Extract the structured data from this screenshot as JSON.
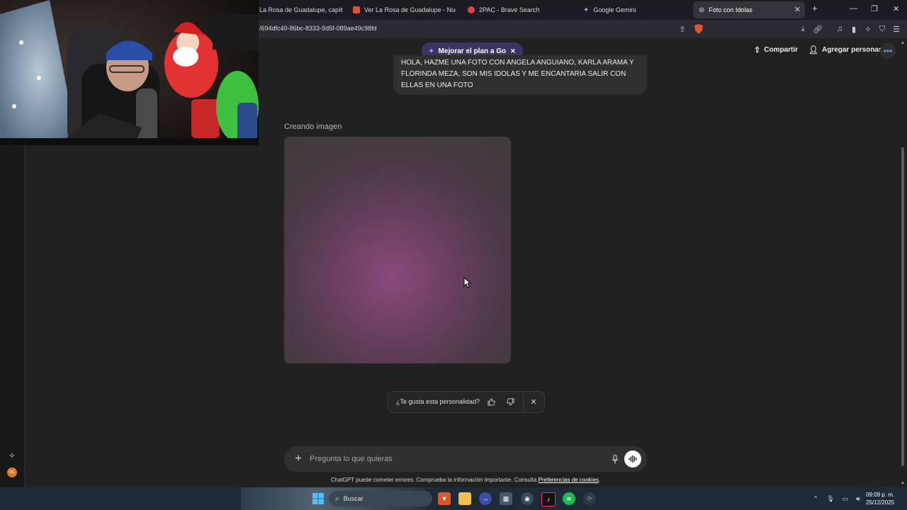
{
  "browser": {
    "tabs": [
      {
        "title": "La Rosa de Guadalupe, capítulo",
        "favicon_color": "#1c1b22"
      },
      {
        "title": "Ver La Rosa de Guadalupe - Nuevos",
        "favicon_color": "#e0552b"
      },
      {
        "title": "2PAC - Brave Search",
        "favicon_color": "#d8434d"
      },
      {
        "title": "Google Gemini",
        "favicon_color": "#8ab4f8"
      },
      {
        "title": "Foto con Idolas",
        "favicon_color": "#bbbbbb",
        "active": true
      }
    ],
    "new_tab": "+",
    "url": "/694dfc40-86bc-8333-9d5f-089ae49c98fd"
  },
  "header": {
    "upgrade_label": "Mejorar el plan a Go",
    "share_label": "Compartir",
    "add_people_label": "Agregar personas"
  },
  "chat": {
    "user_message": "HOLA, HAZME UNA FOTO CON ANGELA ANGUIANO, KARLA ARAMA Y FLORINDA MEZA, SON MIS IDOLAS Y ME ENCANTARIA SALIR CON ELLAS EN UNA FOTO",
    "status_label": "Creando imagen",
    "feedback_question": "¿Te gusta esta personalidad?"
  },
  "composer": {
    "placeholder": "Pregunta lo que quieras"
  },
  "disclaimer": {
    "text": "ChatGPT puede cometer errores. Comprueba la información importante. Consulta",
    "link": "Preferencias de cookies",
    "end": "."
  },
  "sidebar": {
    "avatar_initials": "GC"
  },
  "taskbar": {
    "search_label": "Buscar",
    "time": "09:09 p. m.",
    "date": "25/12/2025"
  },
  "colors": {
    "background": "#212121",
    "accent": "#5fa4ff",
    "upgrade_pill": "#3b3563"
  }
}
